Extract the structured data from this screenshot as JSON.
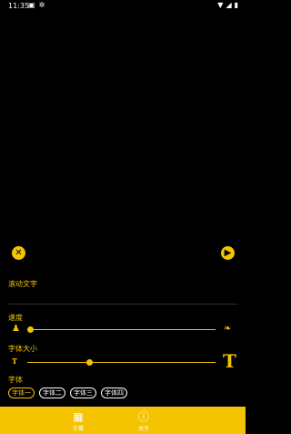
{
  "status_bar": {
    "time": "11:35"
  },
  "controls": {
    "close_symbol": "✕",
    "play_symbol": "▶"
  },
  "scroll_text": {
    "label": "滚动文字"
  },
  "speed": {
    "label": "速度",
    "value_percent": 0
  },
  "font_size": {
    "label": "字体大小",
    "value_percent": 33,
    "small_icon": "T",
    "large_icon": "T"
  },
  "font": {
    "label": "字体",
    "options": [
      "字体一",
      "字体二",
      "字体三",
      "字体四"
    ],
    "selected_index": 0
  },
  "bottom_nav": {
    "items": [
      {
        "label": "字幕",
        "icon": "subtitle-grid-icon"
      },
      {
        "label": "关于",
        "icon": "info-icon"
      }
    ]
  },
  "colors": {
    "accent": "#f5c400",
    "background": "#000000"
  }
}
